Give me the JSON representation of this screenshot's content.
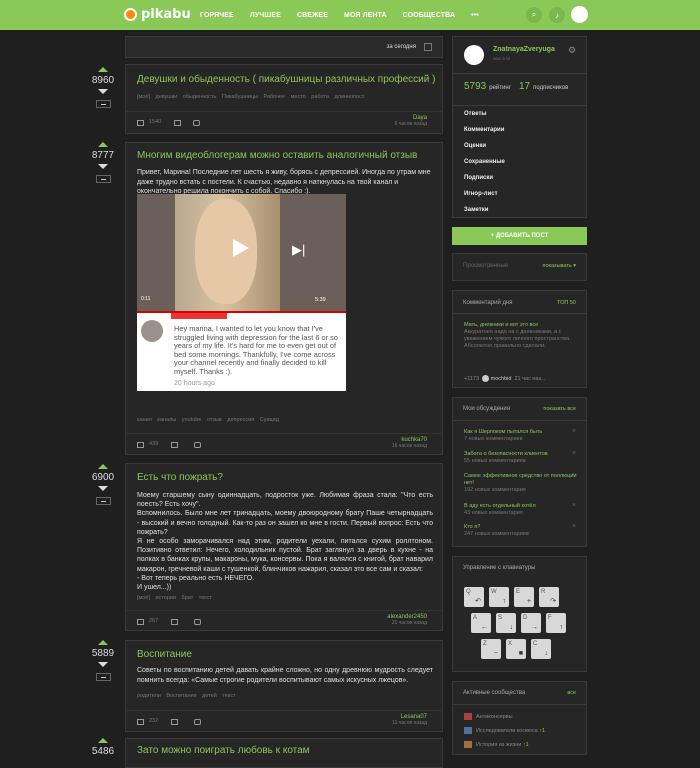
{
  "header": {
    "logo": "pikabu",
    "nav": [
      "ГОРЯЧЕЕ",
      "ЛУЧШЕЕ",
      "СВЕЖЕЕ",
      "МОЯ ЛЕНТА",
      "СООБЩЕСТВА",
      "•••"
    ],
    "search_icon": "search-icon",
    "bell_icon": "bell-icon"
  },
  "feed": {
    "period": "за сегодня",
    "posts": [
      {
        "rating": "8960",
        "title": "Девушки и обыденность ( пикабушницы различных профессий )",
        "tags": "[моё]   девушки   обыденность   Пикабушницы   Рабочее место   работа   длиннопост",
        "comments": "1540",
        "author": "Daya",
        "time": "6 часов назад"
      },
      {
        "rating": "8777",
        "title": "Многим видеоблогерам можно оставить аналогичный отзыв",
        "text": "Привет, Марина! Последние лет шесть я живу, борясь с депрессией. Иногда по утрам мне даже трудно встать с постели. К счастью, недавно я наткнулась на твой канал и окончательно решила покончить с собой. Спасибо :).",
        "video": {
          "start": "0:11",
          "duration": "5:39"
        },
        "comment": {
          "text": "Hey marina, I wanted to let you know that I've struggled living with depression for the last 6 or so years of my life. It's hard for me to even get out of bed some mornings. Thankfully, I've come across your channel recently and finally decided to kill myself. Thanks :).",
          "time": "20 hours ago"
        },
        "tags": "канал   каналы youtube   отзыв   депрессия   Суицид",
        "comments": "439",
        "author": "kuchka70",
        "time": "16 часов назад"
      },
      {
        "rating": "6900",
        "title": "Есть что пожрать?",
        "text": [
          "Моему старшему сыну одиннадцать, подросток уже. Любимая фраза стала: \"Что есть поесть? Есть хочу\".",
          "Вспомнилось. Было мне лет тринадцать, моему двоюродному брату Паше четырнадцать - высокий и вечно голодный. Как-то раз он зашел ко мне в гости. Первый вопрос: Есть что пожрать?",
          "Я не особо заморачивался над этим, родители уехали, питался сухим роллтоном. Позитивно ответил: Нечего, холодильник пустой. Брат заглянул за дверь в кухне - на полках в банках крупы, макароны, мука, консервы. Пока я валялся с книгой, брат наварил макарон, гречневой каши с тушенкой, блинчиков нажарил, сказал это все сам и сказал:",
          "- Вот теперь реально есть НЕЧЕГО.",
          "И ушел...))"
        ],
        "tags": "[моё]   истории   брат   текст",
        "comments": "267",
        "author": "alexander2450",
        "time": "20 часов назад"
      },
      {
        "rating": "5889",
        "title": "Воспитание",
        "text": "Советы по воспитанию детей давать крайне сложно, но одну древнюю мудрость следует помнить всегда: «Самые строгие родители воспитывают самых искусных лжецов».",
        "tags": "родители   Воспитание детей   текст",
        "comments": "232",
        "author": "Lesana07",
        "time": "11 часов назад"
      },
      {
        "rating": "5486",
        "title": "Зато можно поиграть любовь к котам"
      }
    ]
  },
  "sidebar": {
    "user": {
      "name": "ZnatnayaZverуuga",
      "sub": "was 5 lvl",
      "rating": "5793",
      "rating_label": "рейтинг",
      "subs": "17",
      "subs_label": "подписчиков"
    },
    "menu": [
      "Ответы",
      "Комментарии",
      "Оценки",
      "Сохраненные",
      "Подписки",
      "Игнор-лист",
      "Заметки"
    ],
    "add_post": "ДОБАВИТЬ ПОСТ",
    "viewed": {
      "label": "Просмотренные",
      "link": "показывать ▾"
    },
    "comment_day": {
      "title": "Комментарий дня",
      "link": "ТОП 50",
      "post": "Мать, дневники и вот это все",
      "text": "Аккуратнее надо на с дневниками, а с уважением чужого личного пространства. Абсолютно правильно сделали.",
      "score": "+1173",
      "user": "mochbid",
      "time": "21 час наз..."
    },
    "discussions": {
      "title": "Мои обсуждения",
      "link": "показать все",
      "items": [
        {
          "title": "Как я Шерлоком пытался быть",
          "sub": "7 новых комментариев"
        },
        {
          "title": "Забота о безопасности клиентов",
          "sub": "55 новых комментариев"
        },
        {
          "title": "Самое эффективное средство от поллюции нет!",
          "sub": "192 новых комментария"
        },
        {
          "title": "В аду есть отдельный котёл",
          "sub": "43 новых комментария"
        },
        {
          "title": "Кто я?",
          "sub": "247 новых комментариев"
        }
      ]
    },
    "keyboard": {
      "title": "Управление с клавиатуры",
      "keys": [
        {
          "k": "Q",
          "s": "↶"
        },
        {
          "k": "W",
          "s": "↑"
        },
        {
          "k": "E",
          "s": "+"
        },
        {
          "k": "R",
          "s": "↷"
        },
        {
          "k": "A",
          "s": "←"
        },
        {
          "k": "S",
          "s": "↓"
        },
        {
          "k": "D",
          "s": "→"
        },
        {
          "k": "F",
          "s": "↑"
        },
        {
          "k": "Z",
          "s": "−"
        },
        {
          "k": "X",
          "s": "■"
        },
        {
          "k": "C",
          "s": "↓"
        }
      ]
    },
    "communities": {
      "title": "Активные сообщества",
      "link": "все",
      "items": [
        "Антиконсервы",
        "Исследователи космоса",
        "История из жизни"
      ],
      "counts": [
        "",
        "↑1",
        "↑1"
      ]
    }
  },
  "colors": {
    "accent": "#8ac858",
    "bg": "#1f1f1f",
    "card": "#262626"
  }
}
